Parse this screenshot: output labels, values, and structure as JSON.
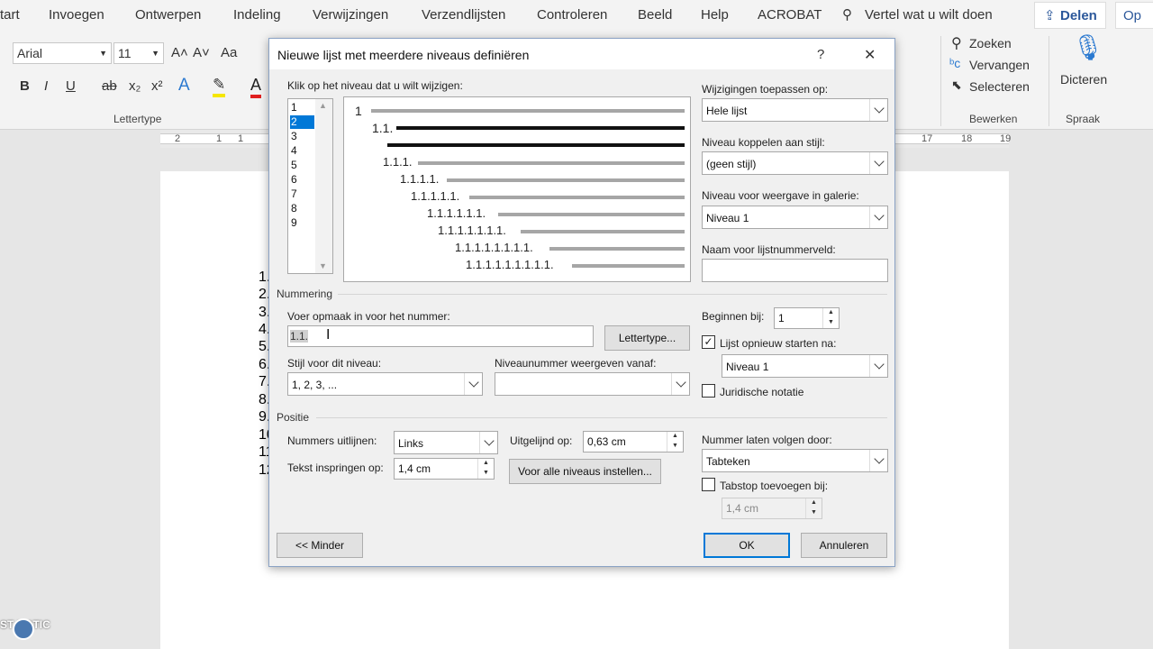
{
  "tabs": [
    "tart",
    "Invoegen",
    "Ontwerpen",
    "Indeling",
    "Verwijzingen",
    "Verzendlijsten",
    "Controleren",
    "Beeld",
    "Help",
    "ACROBAT"
  ],
  "tell_me": "Vertel wat u wilt doen",
  "share": "Delen",
  "share_extra": "Op",
  "ribbon": {
    "font": "Arial",
    "size": "11",
    "case": "Aa",
    "font_group": "Lettertype",
    "find": "Zoeken",
    "replace": "Vervangen",
    "select": "Selecteren",
    "edit_group": "Bewerken",
    "dictate": "Dicteren",
    "voice_group": "Spraak"
  },
  "ruler": [
    "2",
    "1",
    "1",
    "17",
    "18",
    "19"
  ],
  "doc_lines": [
    "1.",
    "2.",
    "3.",
    "4.",
    "5.",
    "6.",
    "7.",
    "8.",
    "9.",
    "10",
    "11",
    "12"
  ],
  "dialog": {
    "title": "Nieuwe lijst met meerdere niveaus definiëren",
    "help": "?",
    "close": "✕",
    "level_prompt": "Klik op het niveau dat u wilt wijzigen:",
    "levels": [
      "1",
      "2",
      "3",
      "4",
      "5",
      "6",
      "7",
      "8",
      "9"
    ],
    "selected_level": "2",
    "preview": [
      "1",
      "1.1.",
      "1.1.1.",
      "1.1.1.1.",
      "1.1.1.1.1.",
      "1.1.1.1.1.1.",
      "1.1.1.1.1.1.1.",
      "1.1.1.1.1.1.1.1.",
      "1.1.1.1.1.1.1.1.1."
    ],
    "apply_label": "Wijzigingen toepassen op:",
    "apply_value": "Hele lijst",
    "link_label": "Niveau koppelen aan stijl:",
    "link_value": "(geen stijl)",
    "gallery_label": "Niveau voor weergave in galerie:",
    "gallery_value": "Niveau 1",
    "listnum_label": "Naam voor lijstnummerveld:",
    "listnum_value": "",
    "numbering_section": "Nummering",
    "format_label": "Voer opmaak in voor het nummer:",
    "format_value": "1.1.",
    "font_button": "Lettertype...",
    "style_label": "Stijl voor dit niveau:",
    "style_value": "1, 2, 3, ...",
    "include_label": "Niveaunummer weergeven vanaf:",
    "include_value": "",
    "start_label": "Beginnen bij:",
    "start_value": "1",
    "restart_label": "Lijst opnieuw starten na:",
    "restart_value": "Niveau 1",
    "legal_label": "Juridische notatie",
    "position_section": "Positie",
    "align_label": "Nummers uitlijnen:",
    "align_value": "Links",
    "aligned_at_label": "Uitgelijnd op:",
    "aligned_at_value": "0,63 cm",
    "indent_label": "Tekst inspringen op:",
    "indent_value": "1,4 cm",
    "all_levels_button": "Voor alle niveaus instellen...",
    "follow_label": "Nummer laten volgen door:",
    "follow_value": "Tabteken",
    "tabstop_label": "Tabstop toevoegen bij:",
    "tabstop_value": "1,4 cm",
    "less_button": "<< Minder",
    "ok_button": "OK",
    "cancel_button": "Annuleren"
  },
  "watermark": "ST  MATIC"
}
